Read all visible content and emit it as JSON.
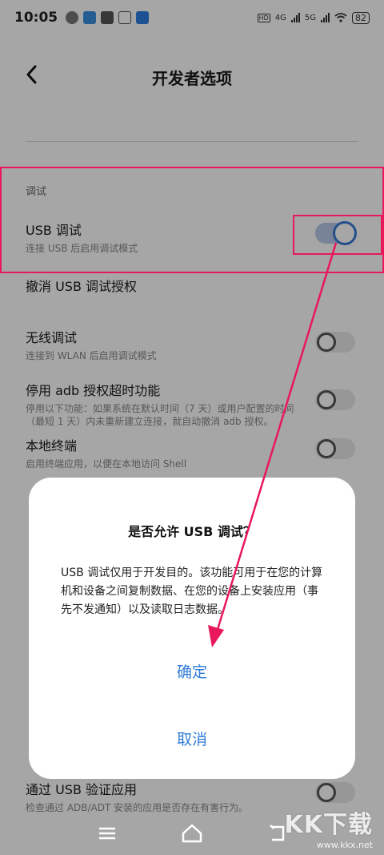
{
  "status_bar": {
    "time": "10:05",
    "network_hd": "HD",
    "network_4g": "4G",
    "network_5g": "5G",
    "battery": "82"
  },
  "header": {
    "title": "开发者选项"
  },
  "section": {
    "label": "调试"
  },
  "settings": [
    {
      "title": "USB 调试",
      "desc": "连接 USB 后启用调试模式",
      "toggle_on": true
    },
    {
      "title": "撤消 USB 调试授权",
      "desc": ""
    },
    {
      "title": "无线调试",
      "desc": "连接到 WLAN 后启用调试模式",
      "toggle_on": false
    },
    {
      "title": "停用 adb 授权超时功能",
      "desc": "停用以下功能：如果系统在默认时间（7 天）或用户配置的时间（最短 1 天）内未重新建立连接，就自动撤消 adb 授权。",
      "toggle_on": false
    },
    {
      "title": "本地终端",
      "desc": "启用终端应用，以便在本地访问 Shell",
      "toggle_on": false
    },
    {
      "title": "通过 USB 验证应用",
      "desc": "检查通过 ADB/ADT 安装的应用是否存在有害行为。",
      "toggle_on": false
    }
  ],
  "dialog": {
    "title": "是否允许 USB 调试？",
    "message": "USB 调试仅用于开发目的。该功能可用于在您的计算机和设备之间复制数据、在您的设备上安装应用（事先不发通知）以及读取日志数据。",
    "ok_label": "确定",
    "cancel_label": "取消"
  },
  "watermark": {
    "brand": "KK下载",
    "url": "www.kkx.net"
  },
  "colors": {
    "accent": "#2f7bd6",
    "highlight": "#e8185a"
  }
}
